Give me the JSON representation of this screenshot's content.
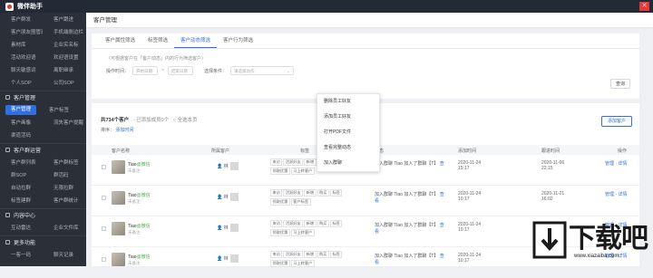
{
  "app": {
    "title": "微伴助手"
  },
  "sidebar": {
    "top_rows": [
      [
        "客户群发",
        "客户跟进"
      ],
      [
        "客户朋友圈管理",
        "手机端侧边栏"
      ],
      [
        "素材库",
        "企业实名标"
      ],
      [
        "活动欢迎语",
        "欢迎语设置"
      ],
      [
        "聊天敏感词",
        "离职继承"
      ],
      [
        "个人SOP",
        "公司SOP"
      ]
    ],
    "section_customer": "客户管理",
    "customer_rows": [
      [
        "客户管理",
        "客户标签"
      ],
      [
        "客户画像",
        "流失客户提醒"
      ],
      [
        "渠道活码",
        ""
      ]
    ],
    "section_group": "客户群运营",
    "group_rows": [
      [
        "客户群列表",
        "客户群标签"
      ],
      [
        "群SOP",
        "群活码"
      ],
      [
        "自动拉群",
        "无限拉群"
      ],
      [
        "标签建群",
        "客户群统计"
      ]
    ],
    "section_content": "内容中心",
    "content_rows": [
      [
        "互动雷达",
        "企业文件库"
      ]
    ],
    "section_more": "更多功能",
    "more_rows": [
      [
        "一客一码",
        "聊天记录"
      ]
    ]
  },
  "page": {
    "title": "客户管理"
  },
  "filter": {
    "tabs": [
      "客户属性筛选",
      "标签筛选",
      "客户动态筛选",
      "客户行为筛选"
    ],
    "active_tab": 2,
    "hint": "（可根据客户在「客户动态」内的行为筛选客户）",
    "time_label": "操作时间：",
    "start_placeholder": "开始日期",
    "to": "~",
    "end_placeholder": "结束日期",
    "cond_label": "选择条件：",
    "cond_placeholder": "请选择动作",
    "query_button": "查询"
  },
  "dropdown": {
    "items": [
      "删除员工好友",
      "添加员工好友",
      "打开PDF文件",
      "查看完整动态",
      "加入群聊"
    ]
  },
  "list": {
    "total": "共734个客户",
    "loaded": "· 已添加成员0个",
    "all_select": "全选本页",
    "sort_label": "排序：",
    "sort_value": "添加时间",
    "add_button": "添加客户",
    "headers": [
      "客户名称",
      "所属客户",
      "标签",
      "动态",
      "添加时间",
      "跟进时间",
      "操作"
    ],
    "rows": [
      {
        "name": "Tiao",
        "tag": "@微信",
        "sub": "未备注",
        "owner": "林",
        "tags": [
          "来访",
          "活跃好友",
          "新增",
          "购买",
          "标签",
          "领取优惠",
          "马上转客户"
        ],
        "dyn": "加入群聊 Tiao 加入了群聊【T】",
        "dyn_link": "查看",
        "t1": "2020-11-24 15:17",
        "t2": "2020-11-06 22:15",
        "ops": "管理 · 详情"
      },
      {
        "name": "Tiao",
        "tag": "@微信",
        "sub": "未备注",
        "owner": "林",
        "tags": [
          "来访",
          "活跃好友",
          "新增",
          "购买",
          "标签",
          "领取优惠",
          "客户标签"
        ],
        "dyn": "加入群聊 Tiao 加入了群聊【T】",
        "dyn_link": "查看",
        "t1": "2020-11-24 10:17",
        "t2": "2020-11-21 16:02",
        "ops": "管理 · 详情"
      },
      {
        "name": "Tiao",
        "tag": "@微信",
        "sub": "未备注",
        "owner": "林",
        "tags": [
          "来访",
          "活跃好友",
          "新增",
          "购买",
          "标签",
          "领取优惠",
          "马上转客户"
        ],
        "dyn": "加入群聊 Tiao 加入了群聊【T】",
        "dyn_link": "查看",
        "t1": "2020-11-24 10:17",
        "t2": "2020-09-21",
        "ops": "管理 · 详情"
      },
      {
        "name": "Tiao",
        "tag": "@微信",
        "sub": "未备注",
        "owner": "林",
        "tags": [
          "来访",
          "活跃好友",
          "新增",
          "购买",
          "标签",
          "领取优惠",
          "马上转客户"
        ],
        "dyn": "加入群聊 Tiao 加入了群聊【T】",
        "dyn_link": "查看",
        "t1": "2020-11-24 10:17",
        "t2": "",
        "ops": "管理 · 详情"
      }
    ]
  },
  "watermark": {
    "text": "下载吧",
    "url": "www.xiazaiba.com"
  }
}
